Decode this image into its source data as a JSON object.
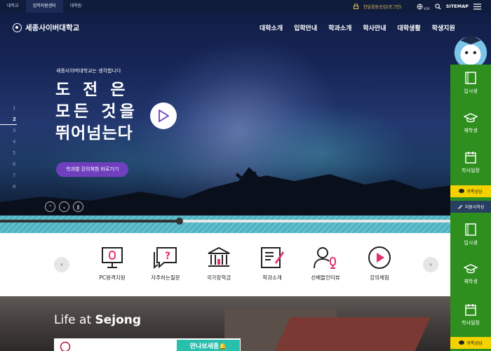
{
  "topbar": {
    "tabs": [
      "대학교",
      "입학지원센터",
      "대학원"
    ],
    "login": "한달음동곳김(로그인)",
    "lang": "KOR",
    "sitemap": "SITEMAP"
  },
  "header": {
    "logo": "세종사이버대학교",
    "nav": [
      "대학소개",
      "입학안내",
      "학과소개",
      "학사안내",
      "대학생활",
      "학생지원"
    ]
  },
  "hero": {
    "subtitle": "세종사이버대학교는 생각합니다",
    "lines": [
      "도 전 은",
      "모든 것을",
      "뛰어넘는다"
    ],
    "cta": "학과별 강의체험 바로가기",
    "slides": [
      "1",
      "2",
      "3",
      "4",
      "5",
      "6",
      "7",
      "8"
    ],
    "active_slide": "2",
    "progress": 0.365
  },
  "quick": {
    "items": [
      "PC원격지원",
      "자주하는질문",
      "국가장학금",
      "학과소개",
      "선배들인터뷰",
      "강의체험"
    ],
    "icons": [
      "monitor-icon",
      "question-chat-icon",
      "bank-icon",
      "notepad-icon",
      "interview-mic-icon",
      "play-circle-icon"
    ]
  },
  "life": {
    "title_light": "Life at ",
    "title_bold": "Sejong",
    "badge": "만나보세종🔔"
  },
  "sidebar": {
    "items_top": [
      "입시생",
      "재학생",
      "학사일정"
    ],
    "kakao": "카톡상담",
    "apply": "지원서작성",
    "items_bottom": [
      "입시생",
      "재학생",
      "학사일정"
    ],
    "kakao2": "카톡상담"
  },
  "colors": {
    "topbar": "#101c3c",
    "sidebar": "#2e8f1e",
    "accent_pink": "#e5306e",
    "cta": "#6f3fbe"
  }
}
